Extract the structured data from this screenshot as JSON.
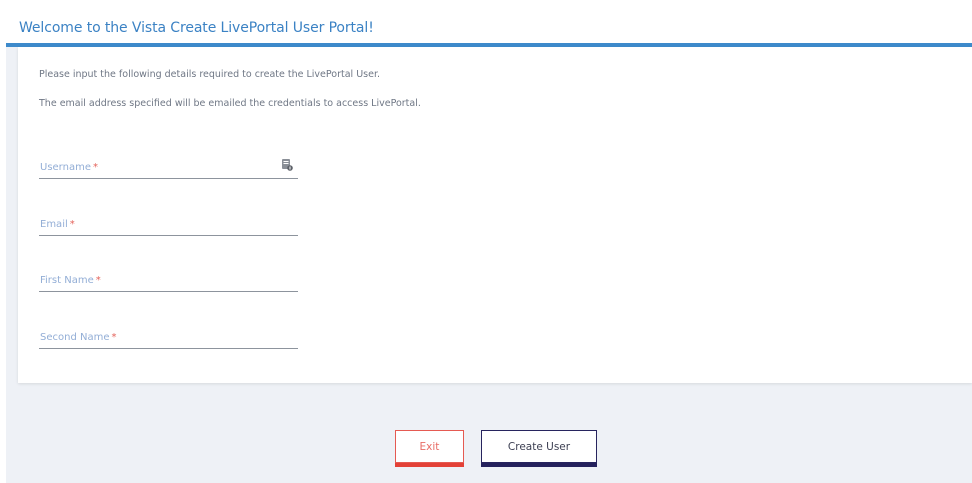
{
  "header": {
    "title": "Welcome to the Vista Create LivePortal User Portal!"
  },
  "intro": {
    "line1": "Please input the following details required to create the LivePortal User.",
    "line2": "The email address specified will be emailed the credentials to access LivePortal."
  },
  "fields": {
    "username": {
      "label": "Username",
      "required_mark": "*",
      "value": "",
      "icon": "contact-card-icon"
    },
    "email": {
      "label": "Email",
      "required_mark": "*",
      "value": ""
    },
    "first_name": {
      "label": "First Name",
      "required_mark": "*",
      "value": ""
    },
    "second_name": {
      "label": "Second Name",
      "required_mark": "*",
      "value": ""
    }
  },
  "actions": {
    "exit_label": "Exit",
    "create_label": "Create User"
  },
  "colors": {
    "accent_blue": "#3d8acb",
    "exit_red": "#e34137",
    "create_navy": "#24215c"
  }
}
